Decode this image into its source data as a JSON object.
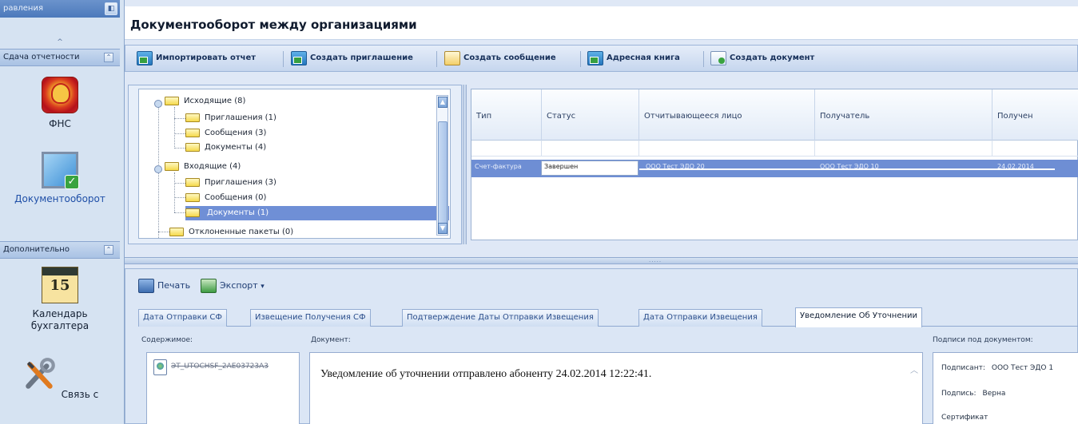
{
  "nav": {
    "header_label": "равления",
    "collapse_glyph": "^",
    "group1": "Сдача отчетности",
    "group2": "Дополнительно",
    "items": [
      {
        "label": "ФНС",
        "icon": "fns-emblem-icon"
      },
      {
        "label": "Документооборот",
        "icon": "document-flow-icon"
      },
      {
        "label": "Календарь бухгалтера",
        "icon": "calendar-icon",
        "calendar_day": "15"
      },
      {
        "label": "Связь с",
        "icon": "tools-icon"
      }
    ]
  },
  "header": {
    "title": "Документооборот между организациями"
  },
  "toolbar": {
    "import_report": "Импортировать отчет",
    "create_invitation": "Создать приглашение",
    "create_message": "Создать сообщение",
    "address_book": "Адресная книга",
    "create_document": "Создать документ"
  },
  "tree": {
    "outgoing": "Исходящие (8)",
    "out_invitations": "Приглашения (1)",
    "out_messages": "Сообщения (3)",
    "out_documents": "Документы (4)",
    "incoming": "Входящие (4)",
    "in_invitations": "Приглашения (3)",
    "in_messages": "Сообщения (0)",
    "in_documents": "Документы (1)",
    "rejected": "Отклоненные пакеты (0)"
  },
  "grid": {
    "columns": [
      "Тип",
      "Статус",
      "Отчитывающееся лицо",
      "Получатель",
      "Получен"
    ],
    "row": {
      "type": "Счет-фактура",
      "status": "Завершен",
      "reporter": "ООО Тест ЭДО 20",
      "recipient": "ООО Тест ЭДО 10",
      "received": "24.02.2014"
    }
  },
  "bottom": {
    "print": "Печать",
    "export": "Экспорт",
    "export_caret": "▾",
    "tabs": [
      "Дата Отправки СФ",
      "Извещение Получения СФ",
      "Подтверждение Даты Отправки Извещения",
      "Дата Отправки Извещения",
      "Уведомление Об Уточнении"
    ],
    "contents_label": "Содержимое:",
    "document_label": "Документ:",
    "signatures_label": "Подписи под документом:",
    "file_name": "ЭТ_UTOCHSF_2AE03723A3",
    "document_text": "Уведомление об уточнении отправлено абоненту 24.02.2014 12:22:41.",
    "signer_label": "Подписант:",
    "signer_value": "ООО Тест ЭДО 1",
    "signature_label": "Подпись:",
    "signature_value": "Верна",
    "certificate_label": "Сертификат"
  },
  "colors": {
    "accent": "#6f8fd6",
    "toolbar": "#c6d6ee",
    "nav": "#d6e3f2"
  }
}
